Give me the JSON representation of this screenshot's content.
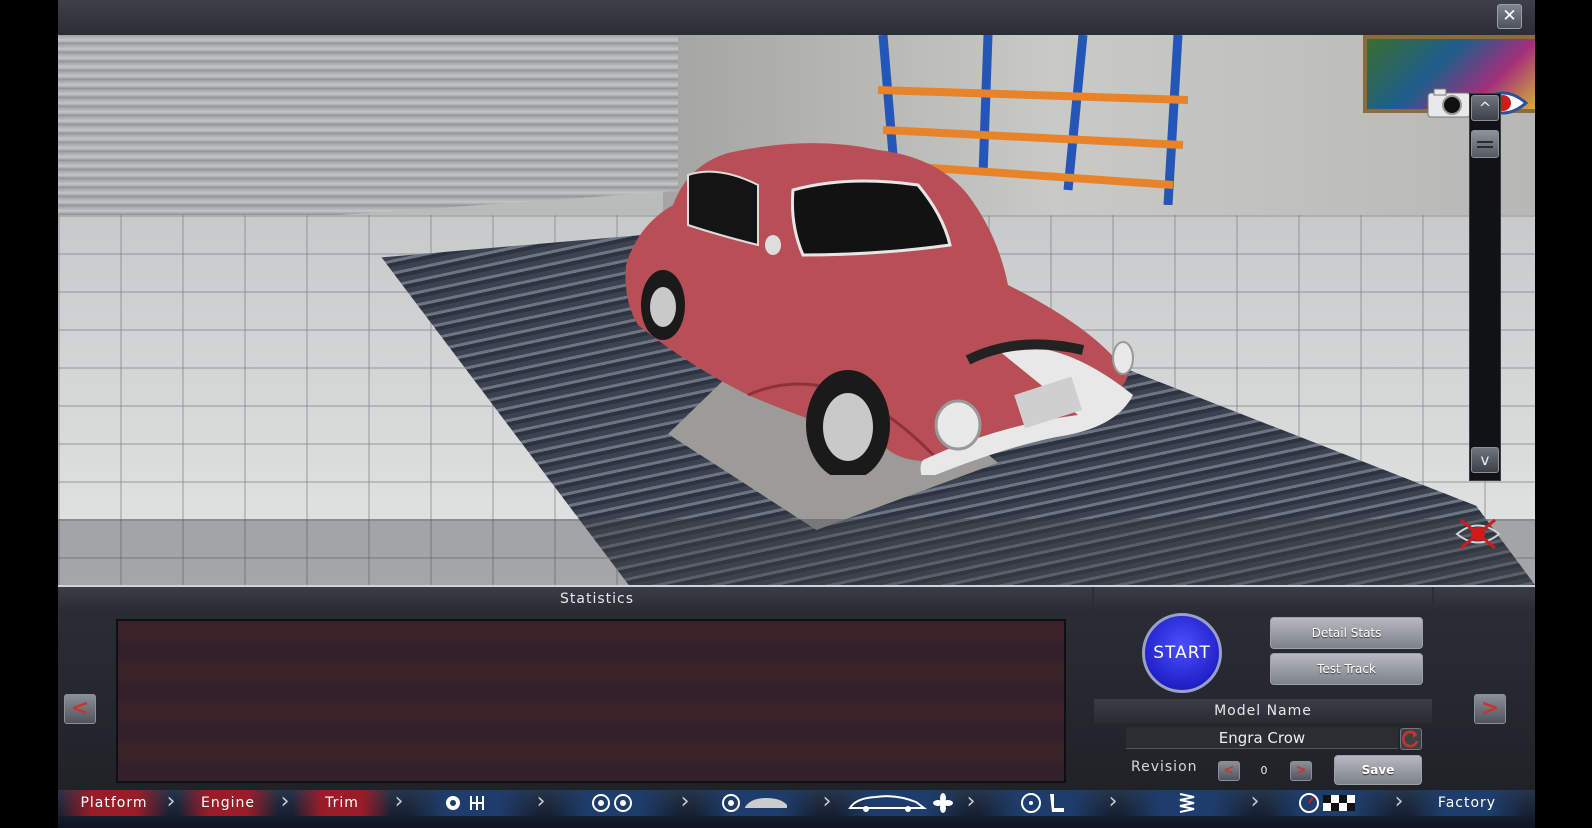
{
  "window": {
    "close_icon": "close-icon"
  },
  "viewport": {
    "tools": [
      "camera-icon",
      "eye-icon",
      "scroll-up-icon",
      "scroll-down-icon",
      "view-toggle-icon"
    ],
    "scroll_up_label": "^",
    "scroll_down_label": "v"
  },
  "panel": {
    "statistics_title": "Statistics",
    "prev_label": "<",
    "next_label": ">",
    "start_label": "START",
    "detail_stats_label": "Detail Stats",
    "test_track_label": "Test Track",
    "model_name_label": "Model Name",
    "model_name_value": "Engra Crow",
    "revision_label": "Revision",
    "revision_value": "0",
    "revision_prev": "<",
    "revision_next": ">",
    "save_label": "Save"
  },
  "tabs": [
    {
      "label": "Platform",
      "state": "completed"
    },
    {
      "label": "Engine",
      "state": "completed"
    },
    {
      "label": "Trim",
      "state": "active"
    },
    {
      "icon": "gear-and-gearbox-icons",
      "state": "upcoming"
    },
    {
      "icon": "wheels-icon",
      "state": "upcoming"
    },
    {
      "icon": "brake-and-body-icon",
      "state": "upcoming"
    },
    {
      "icon": "car-and-fan-icon",
      "state": "upcoming"
    },
    {
      "icon": "steering-and-seat-icon",
      "state": "upcoming"
    },
    {
      "icon": "suspension-icon",
      "state": "upcoming"
    },
    {
      "icon": "testing-icon",
      "state": "upcoming"
    },
    {
      "label": "Factory",
      "state": "upcoming"
    }
  ],
  "colors": {
    "car_body": "#b84f56",
    "active_tab": "#9a1c28",
    "start_button": "#2727d8",
    "stats_stripe": "#3b2229"
  }
}
